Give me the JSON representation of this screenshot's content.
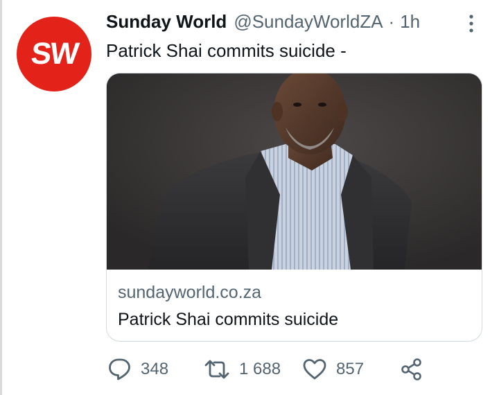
{
  "account": {
    "avatar_text": "SW",
    "display_name": "Sunday World",
    "handle": "@SundayWorldZA",
    "separator": "·",
    "time": "1h"
  },
  "tweet": {
    "text": "Patrick Shai commits suicide -"
  },
  "card": {
    "domain": "sundayworld.co.za",
    "title": "Patrick Shai commits suicide"
  },
  "actions": {
    "reply_count": "348",
    "retweet_count": "1 688",
    "like_count": "857"
  },
  "icons": {
    "reply": "reply-icon",
    "retweet": "retweet-icon",
    "like": "like-icon",
    "share": "share-icon",
    "more": "more-icon"
  },
  "colors": {
    "avatar_bg": "#e32219",
    "text_primary": "#0f1419",
    "text_secondary": "#536471",
    "card_border": "#cfd9de",
    "icon": "#536471"
  }
}
